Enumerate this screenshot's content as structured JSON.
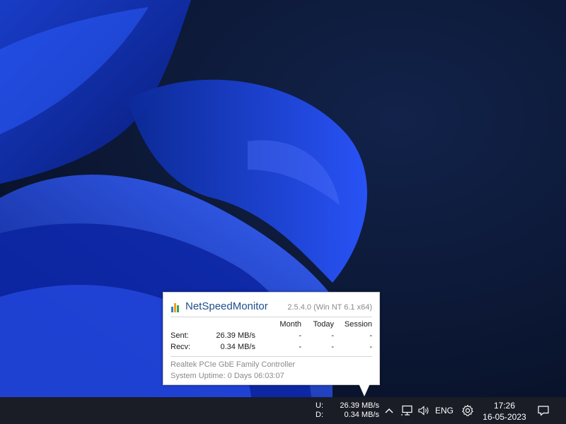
{
  "popup": {
    "app_name": "NetSpeedMonitor",
    "version": "2.5.4.0 (Win NT 6.1 x64)",
    "headers": {
      "month": "Month",
      "today": "Today",
      "session": "Session"
    },
    "rows": [
      {
        "label": "Sent:",
        "rate": "26.39 MB/s",
        "month": "-",
        "today": "-",
        "session": "-"
      },
      {
        "label": "Recv:",
        "rate": "0.34 MB/s",
        "month": "-",
        "today": "-",
        "session": "-"
      }
    ],
    "adapter": "Realtek PCIe GbE Family Controller",
    "uptime": "System Uptime: 0 Days 06:03:07",
    "icon_colors": [
      "#2f7fd4",
      "#f0a020",
      "#2fa84f"
    ]
  },
  "taskbar": {
    "upload_label": "U:",
    "download_label": "D:",
    "upload_value": "26.39 MB/s",
    "download_value": "0.34 MB/s",
    "language": "ENG",
    "time": "17:26",
    "date": "16-05-2023",
    "tray_icons": [
      "chevron-up-icon",
      "network-icon",
      "speaker-icon",
      "gear-icon",
      "notification-icon"
    ]
  },
  "colors": {
    "taskbar_bg": "#1a1c26",
    "desktop_bg": "#0a1430",
    "app_name": "#1f4e8c"
  }
}
